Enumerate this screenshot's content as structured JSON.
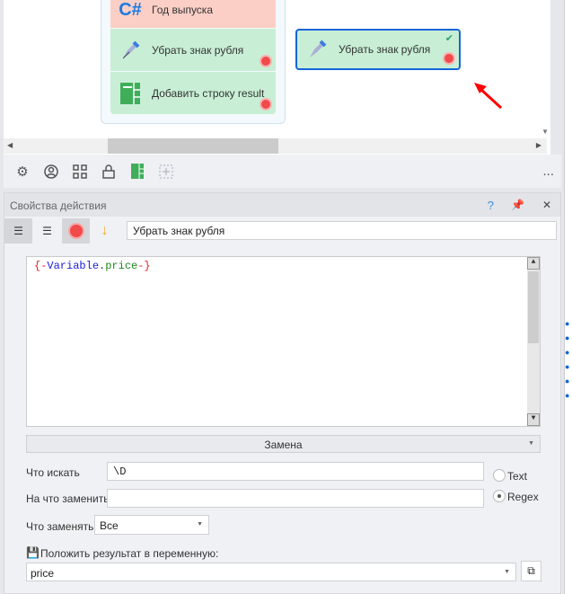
{
  "canvas": {
    "group_nodes": [
      {
        "label": "Год выпуска",
        "icon": "csharp-icon",
        "icon_text": "C#"
      },
      {
        "label": "Убрать знак рубля",
        "icon": "pen-icon"
      },
      {
        "label": "Добавить строку result",
        "icon": "table-icon"
      }
    ],
    "selected_node": {
      "label": "Убрать знак рубля",
      "icon": "pen-icon"
    }
  },
  "toolbar": {
    "icons": [
      "gear-icon",
      "user-icon",
      "grid-icon",
      "lock-icon",
      "table-icon",
      "add-icon"
    ],
    "more": "..."
  },
  "panel": {
    "title": "Свойства действия",
    "help": "?",
    "close": "✕",
    "action_name": "Убрать знак рубля",
    "editor": {
      "open": "{-",
      "var": "Variable",
      "dot": ".",
      "field": "price",
      "close": "-}"
    },
    "mode": "Замена",
    "find_label": "Что искать",
    "find_value": "\\D",
    "replace_label": "На что заменить",
    "replace_value": "",
    "radio_text": "Text",
    "radio_regex": "Regex",
    "which_label": "Что заменять",
    "which_value": "Все",
    "result_label": "Положить результат в переменную:",
    "result_value": "price"
  },
  "colors": {
    "accent": "#1565d8",
    "node_green": "#c8efd5",
    "node_red": "#fbcfc6"
  }
}
